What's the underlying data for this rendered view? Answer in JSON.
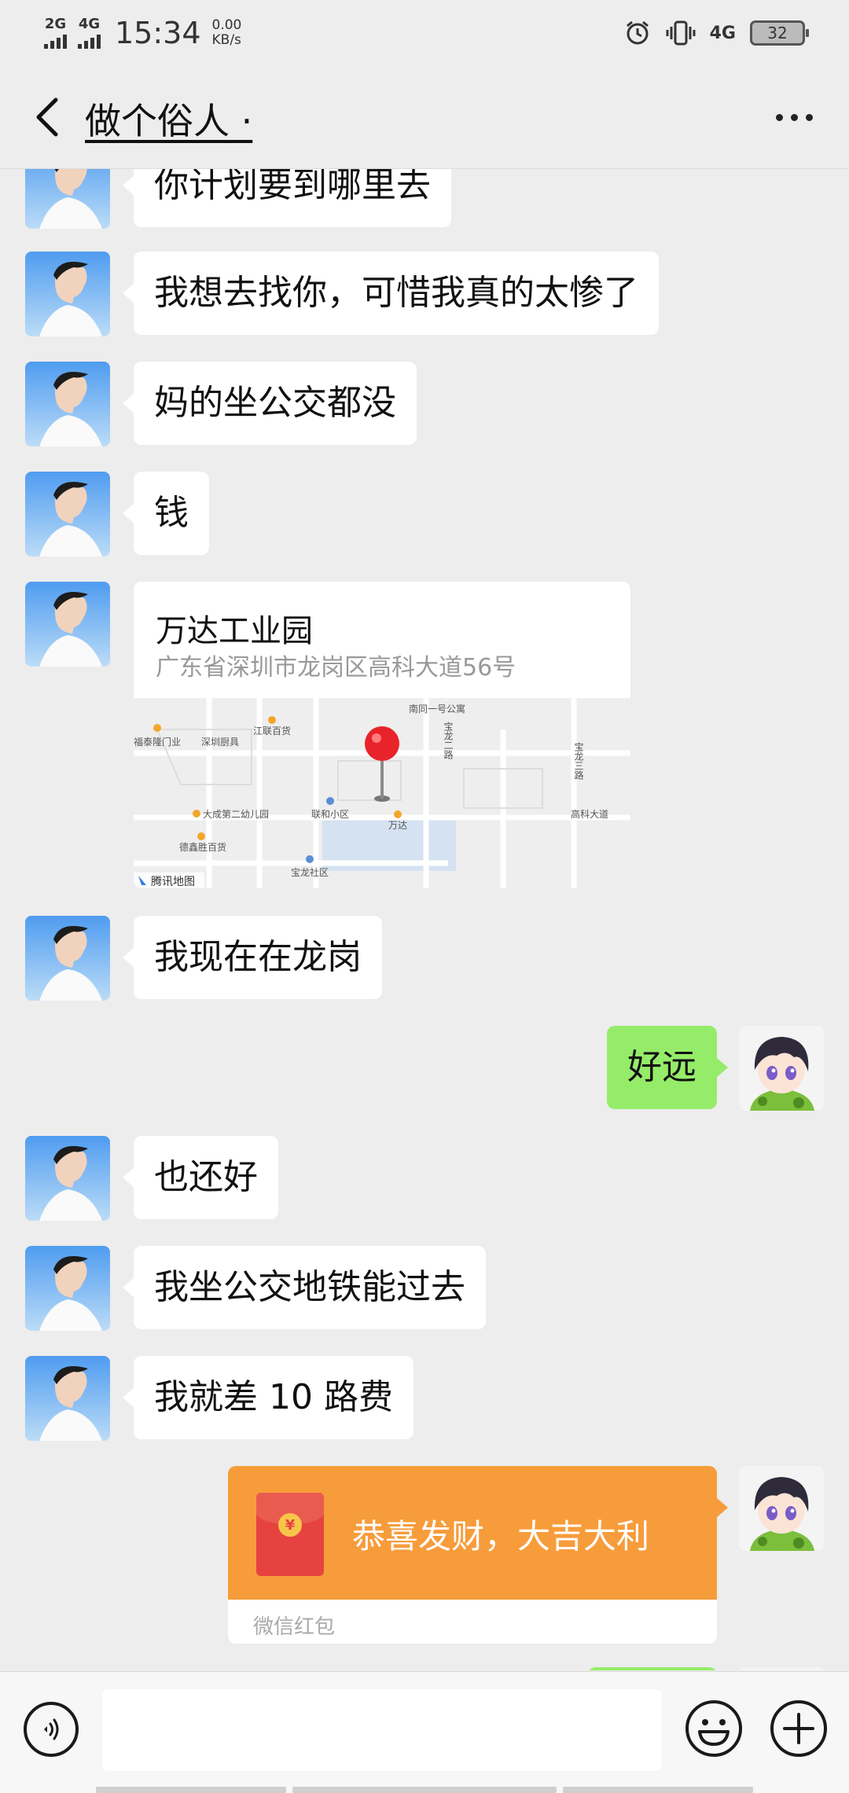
{
  "status_bar": {
    "signal_1": "2G",
    "signal_2": "4G",
    "time": "15:34",
    "speed_value": "0.00",
    "speed_unit": "KB/s",
    "network": "4G",
    "battery": "32",
    "icons": [
      "alarm-icon",
      "vibrate-icon"
    ]
  },
  "nav": {
    "title": "做个俗人 ·",
    "back_icon": "chevron-left-icon",
    "more_icon": "more-dots-icon"
  },
  "messages": [
    {
      "side": "left",
      "text": "你计划要到哪里去"
    },
    {
      "side": "left",
      "text": "我想去找你，可惜我真的太惨了"
    },
    {
      "side": "left",
      "text": "妈的坐公交都没"
    },
    {
      "side": "left",
      "text": "钱"
    },
    {
      "side": "left",
      "type": "location",
      "name": "万达工业园",
      "address": "广东省深圳市龙岗区高科大道56号",
      "map_provider": "腾讯地图"
    },
    {
      "side": "left",
      "text": "我现在在龙岗"
    },
    {
      "side": "right",
      "text": "好远"
    },
    {
      "side": "left",
      "text": "也还好"
    },
    {
      "side": "left",
      "text": "我坐公交地铁能过去"
    },
    {
      "side": "left",
      "text": "我就差 10 路费"
    },
    {
      "side": "right",
      "type": "red_packet",
      "text": "恭喜发财，大吉大利",
      "label": "微信红包"
    }
  ],
  "map_labels": {
    "l1": "南同一号公寓",
    "l2": "福泰隆门业",
    "l3": "深圳厨具",
    "l4": "江联百货",
    "l5": "宝龙二路",
    "l6": "宝龙三路",
    "l7": "大成第二幼儿园",
    "l8": "联和小区",
    "l9": "万达",
    "l10": "高科大道",
    "l11": "德鑫胜百货",
    "l12": "宝龙社区"
  },
  "colors": {
    "background": "#ededed",
    "bubble_self": "#95ec69",
    "bubble_other": "#ffffff",
    "red_packet": "#f79c3b"
  },
  "input": {
    "value": "",
    "voice_icon": "voice-icon",
    "emoji_icon": "emoji-icon",
    "plus_icon": "plus-icon"
  }
}
